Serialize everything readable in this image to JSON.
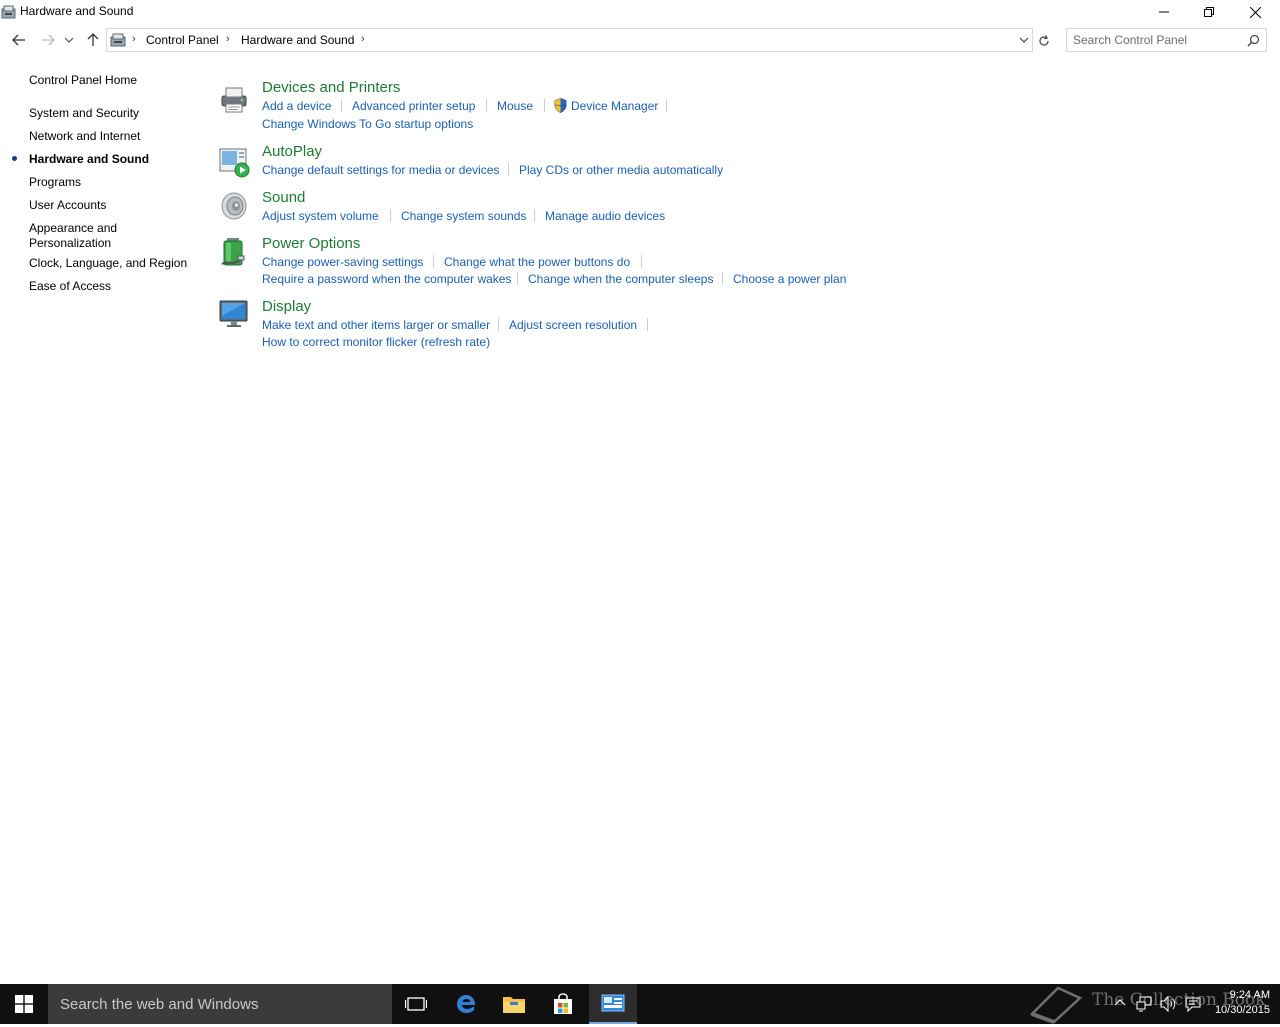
{
  "window": {
    "title": "Hardware and Sound"
  },
  "address_bar": {
    "crumbs": [
      "Control Panel",
      "Hardware and Sound"
    ],
    "search_placeholder": "Search Control Panel"
  },
  "left_nav": {
    "items": [
      {
        "label": "Control Panel Home"
      },
      {
        "label": "System and Security"
      },
      {
        "label": "Network and Internet"
      },
      {
        "label": "Hardware and Sound",
        "active": true
      },
      {
        "label": "Programs"
      },
      {
        "label": "User Accounts"
      },
      {
        "label": "Appearance and",
        "label2": "Personalization"
      },
      {
        "label": "Clock, Language, and Region"
      },
      {
        "label": "Ease of Access"
      }
    ]
  },
  "categories": [
    {
      "title": "Devices and Printers",
      "icon": "printer-icon",
      "links": [
        "Add a device",
        "Advanced printer setup",
        "Mouse",
        "Device Manager",
        "Change Windows To Go startup options"
      ]
    },
    {
      "title": "AutoPlay",
      "icon": "autoplay-icon",
      "links": [
        "Change default settings for media or devices",
        "Play CDs or other media automatically"
      ]
    },
    {
      "title": "Sound",
      "icon": "speaker-icon",
      "links": [
        "Adjust system volume",
        "Change system sounds",
        "Manage audio devices"
      ]
    },
    {
      "title": "Power Options",
      "icon": "battery-icon",
      "links": [
        "Change power-saving settings",
        "Change what the power buttons do",
        "Require a password when the computer wakes",
        "Change when the computer sleeps",
        "Choose a power plan"
      ]
    },
    {
      "title": "Display",
      "icon": "monitor-icon",
      "links": [
        "Make text and other items larger or smaller",
        "Adjust screen resolution",
        "How to correct monitor flicker (refresh rate)"
      ]
    }
  ],
  "taskbar": {
    "search_text": "Search the web and Windows",
    "time": "9:24 AM",
    "date": "10/30/2015",
    "watermark": "The Collection Book"
  },
  "colors": {
    "category_title": "#1e7b34",
    "link": "#1a5fb4",
    "taskbar": "#101010"
  }
}
